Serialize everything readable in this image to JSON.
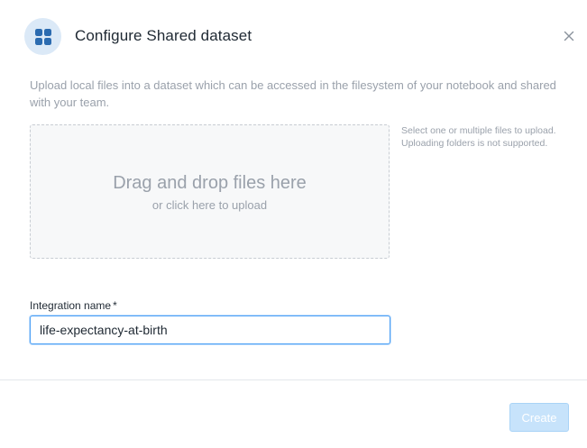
{
  "dialog": {
    "title": "Configure Shared dataset",
    "header_icon": "grid-icon",
    "close_icon": "close-icon"
  },
  "description": "Upload local files into a dataset which can be accessed in the filesystem of your notebook and shared with your team.",
  "dropzone": {
    "title": "Drag and drop files here",
    "subtitle": "or click here to upload"
  },
  "upload_hint": "Select one or multiple files to upload. Uploading folders is not supported.",
  "integration_name": {
    "label": "Integration name",
    "required_marker": "*",
    "value": "life-expectancy-at-birth"
  },
  "footer": {
    "create_label": "Create",
    "create_disabled": true
  },
  "colors": {
    "accent": "#4a9ff5",
    "icon_circle": "#dbe9f7",
    "icon_squares": "#2b6bb0",
    "disabled_button": "#c7e3fb"
  }
}
